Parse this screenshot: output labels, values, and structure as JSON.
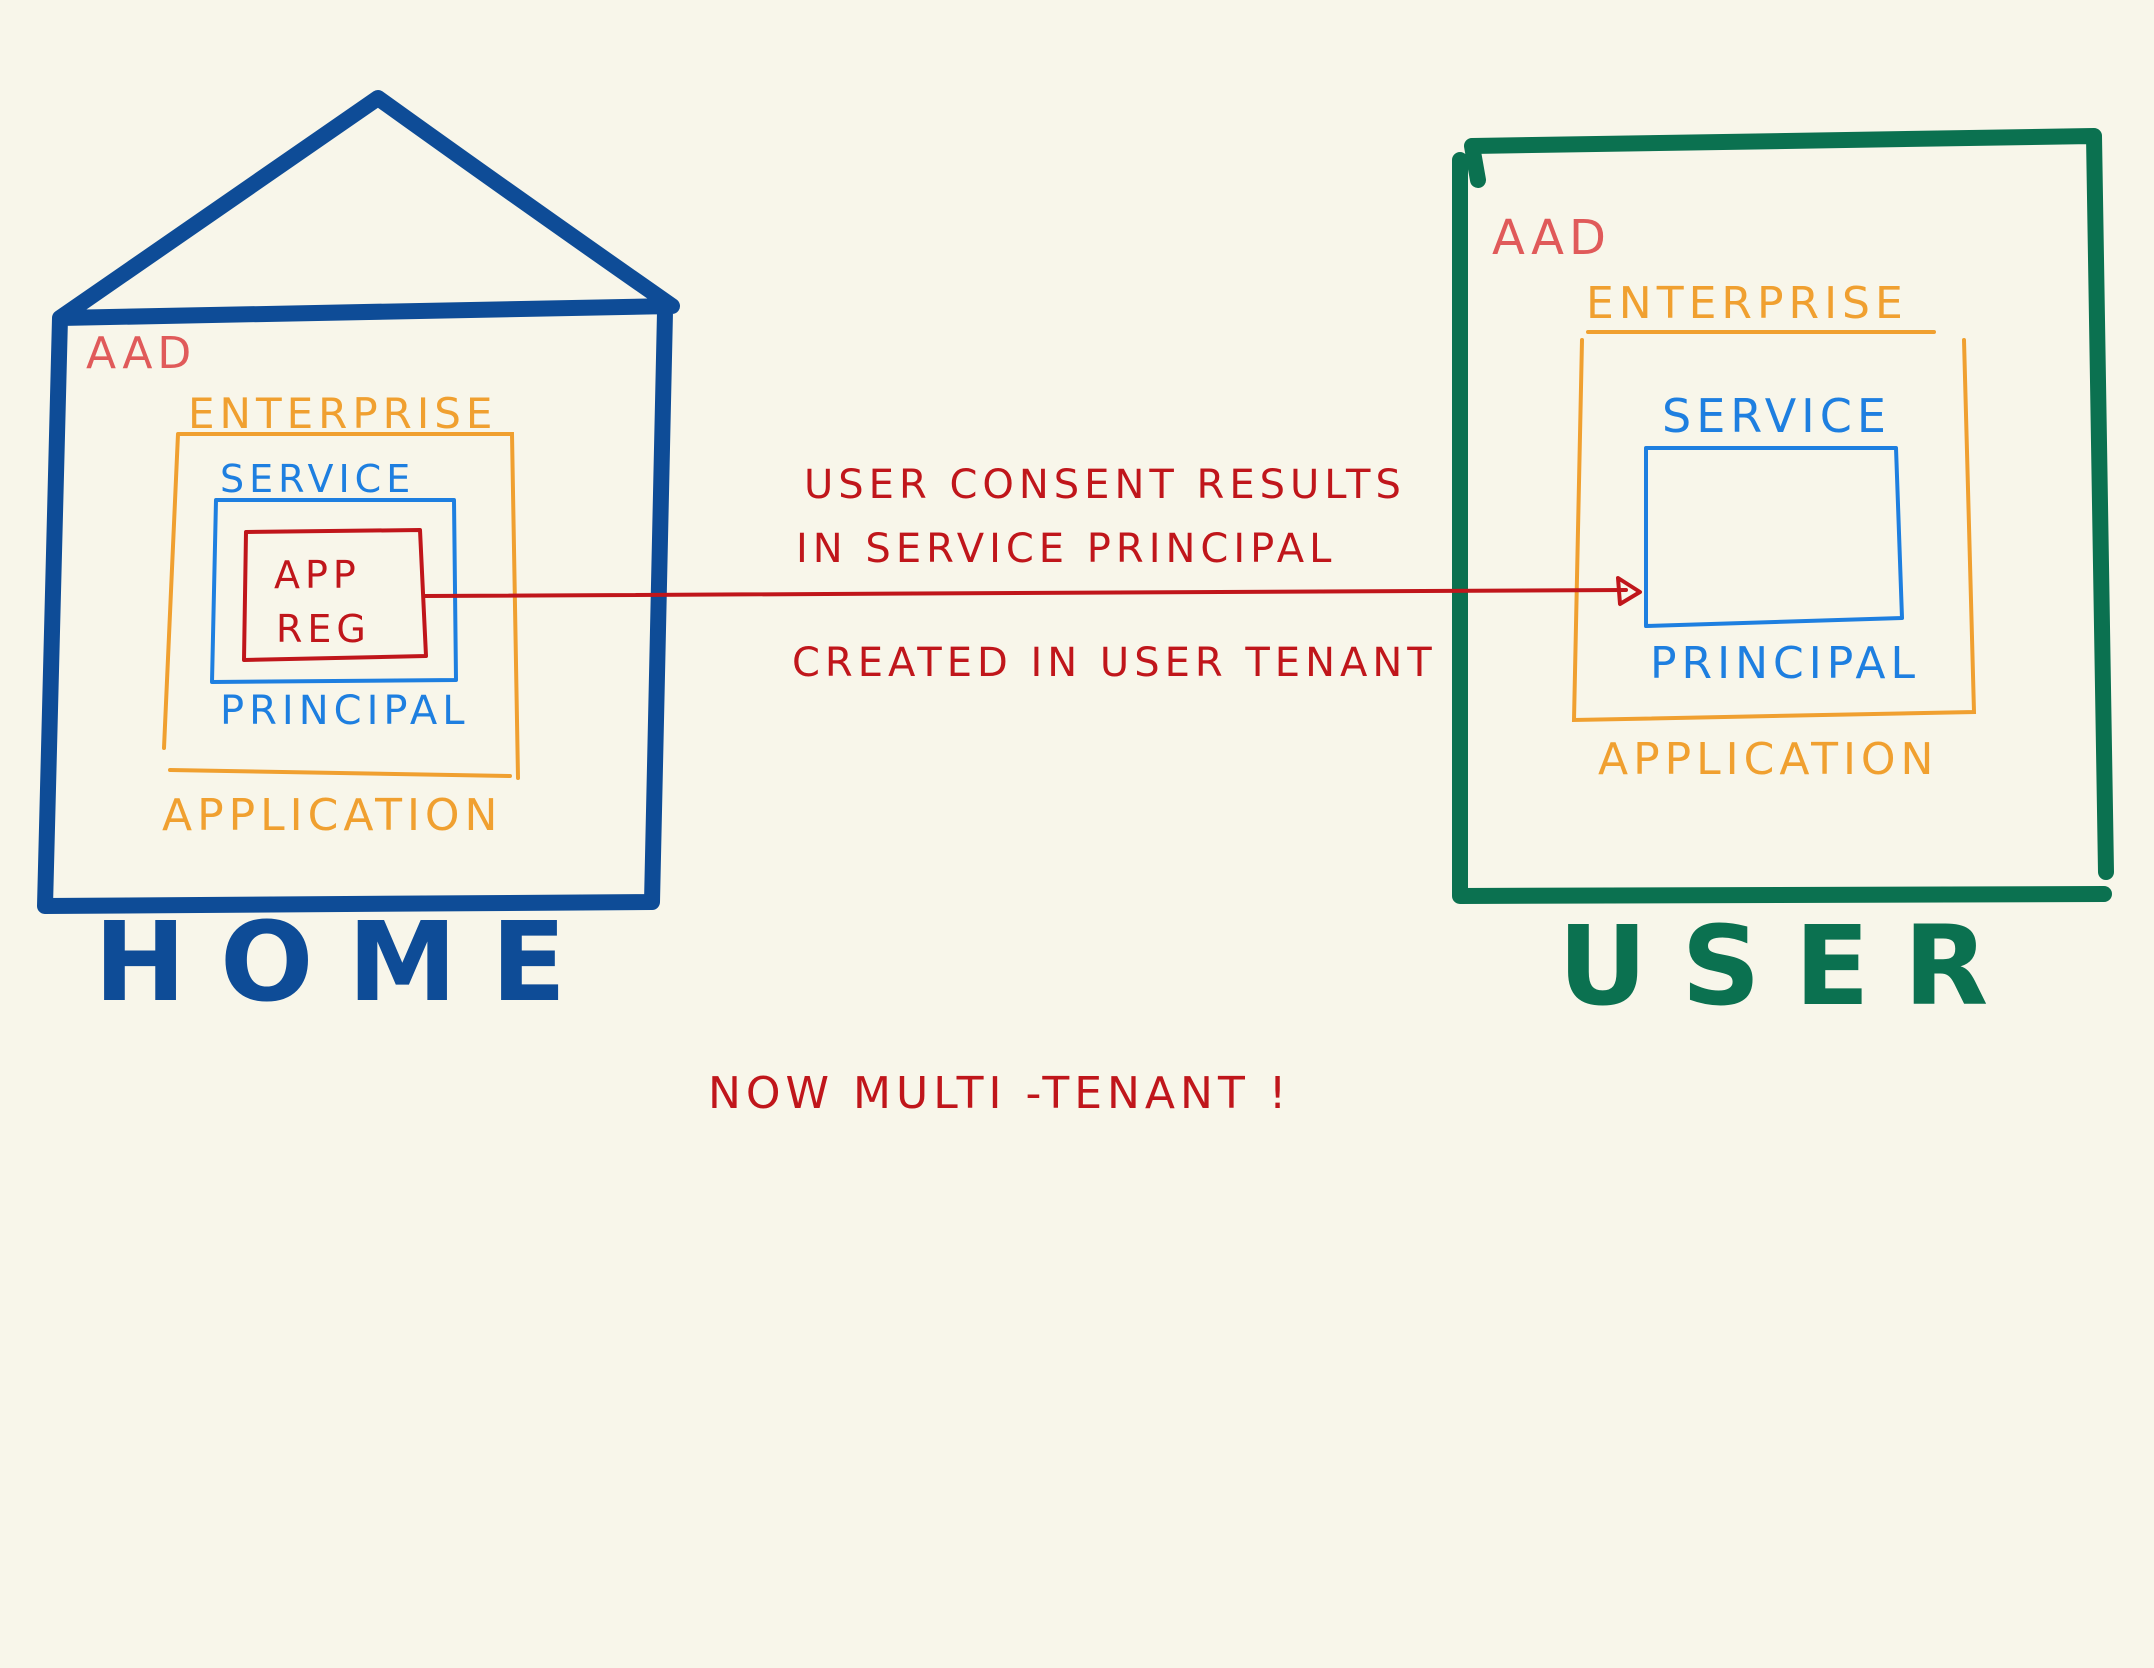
{
  "colors": {
    "background": "#f8f6ea",
    "home_blue": "#0e4c97",
    "user_green": "#0b7150",
    "aad_red": "#e05a5a",
    "enterprise_orange": "#f0a030",
    "service_blue": "#1e7fe0",
    "app_reg_red": "#c0161b",
    "annotation_red": "#c0161b"
  },
  "home": {
    "name": "HOME",
    "aad": "AAD",
    "enterprise": "ENTERPRISE",
    "service": "SERVICE",
    "app_reg_line1": "APP",
    "app_reg_line2": "REG",
    "principal": "PRINCIPAL",
    "application": "APPLICATION"
  },
  "user": {
    "name": "USER",
    "aad": "AAD",
    "enterprise": "ENTERPRISE",
    "service": "SERVICE",
    "principal": "PRINCIPAL",
    "application": "APPLICATION"
  },
  "annotation": {
    "line1": "USER CONSENT RESULTS",
    "line2": "IN SERVICE PRINCIPAL",
    "line3": "CREATED IN USER TENANT"
  },
  "footer_note": "NOW MULTI -TENANT !"
}
